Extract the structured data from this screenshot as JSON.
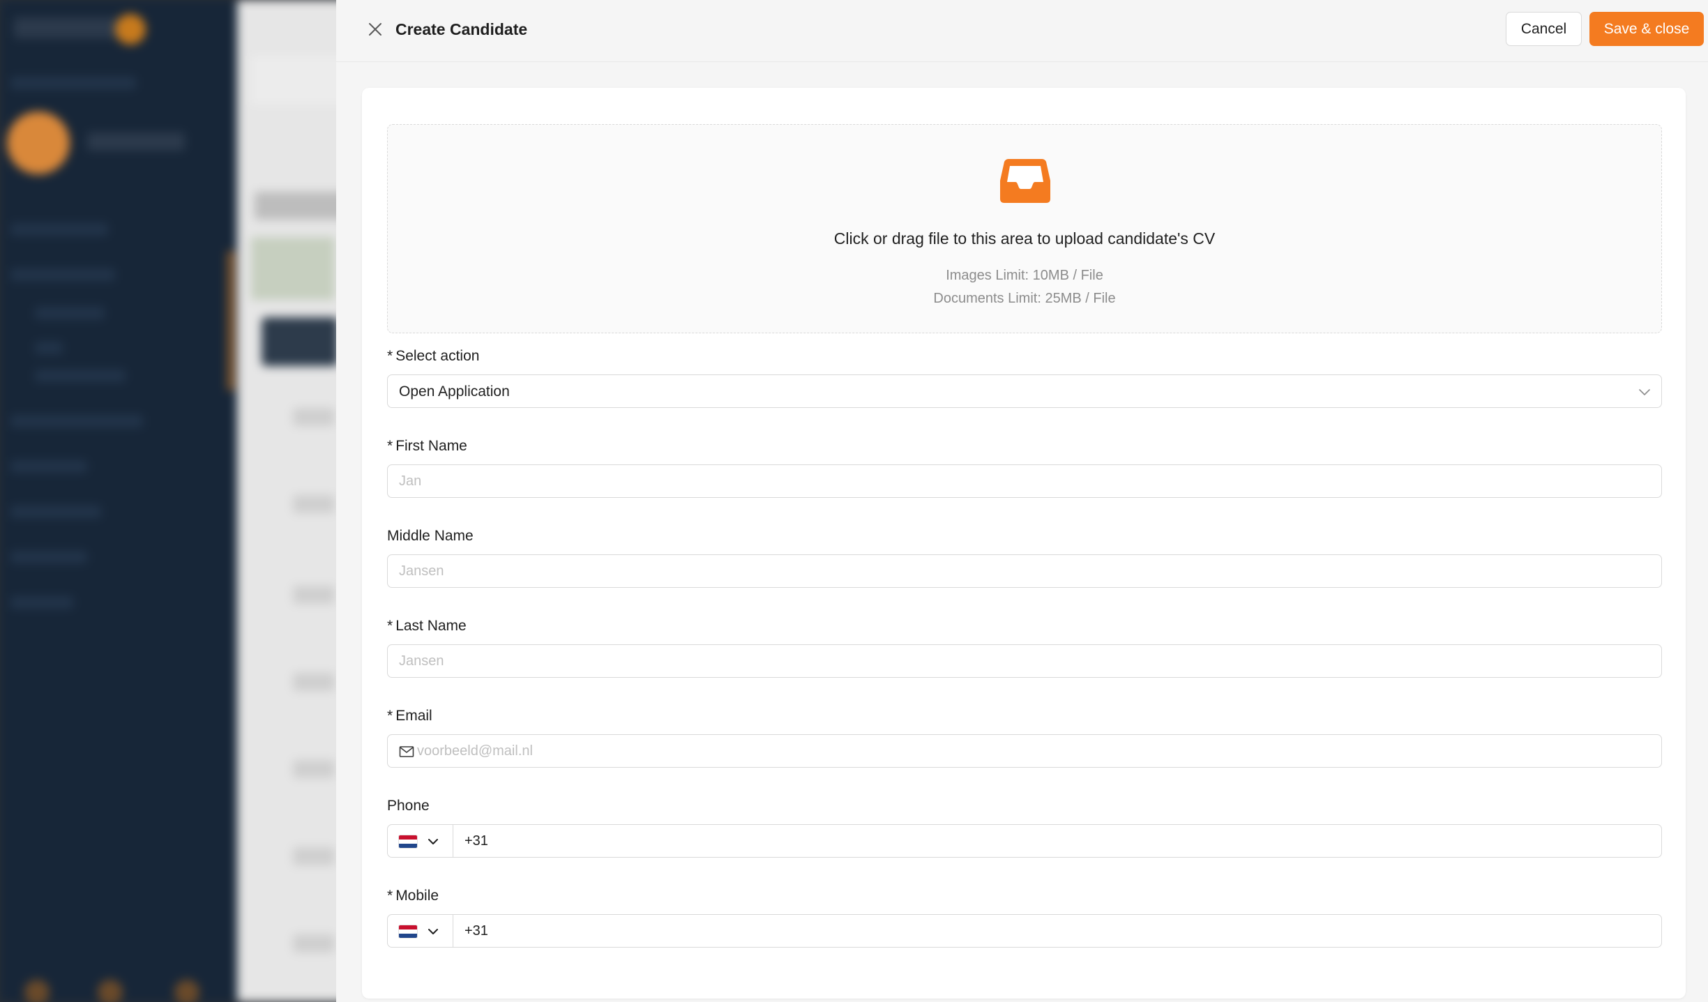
{
  "drawer": {
    "title": "Create Candidate",
    "cancel_label": "Cancel",
    "save_label": "Save & close"
  },
  "upload": {
    "text": "Click or drag file to this area to upload candidate's CV",
    "images_limit": "Images Limit: 10MB / File",
    "documents_limit": "Documents Limit: 25MB / File",
    "icon": "inbox-icon"
  },
  "form": {
    "select_action": {
      "label": "Select action",
      "required": "*",
      "value": "Open Application"
    },
    "first_name": {
      "label": "First Name",
      "required": "*",
      "placeholder": "Jan"
    },
    "middle_name": {
      "label": "Middle Name",
      "placeholder": "Jansen"
    },
    "last_name": {
      "label": "Last Name",
      "required": "*",
      "placeholder": "Jansen"
    },
    "email": {
      "label": "Email",
      "required": "*",
      "placeholder": "voorbeeld@mail.nl",
      "icon": "mail-icon"
    },
    "phone": {
      "label": "Phone",
      "value": "+31",
      "flag": "netherlands-flag-icon"
    },
    "mobile": {
      "label": "Mobile",
      "required": "*",
      "value": "+31",
      "flag": "netherlands-flag-icon"
    }
  },
  "colors": {
    "accent": "#f47b20",
    "sidebar": "#172638",
    "border": "#d9d9d9"
  }
}
